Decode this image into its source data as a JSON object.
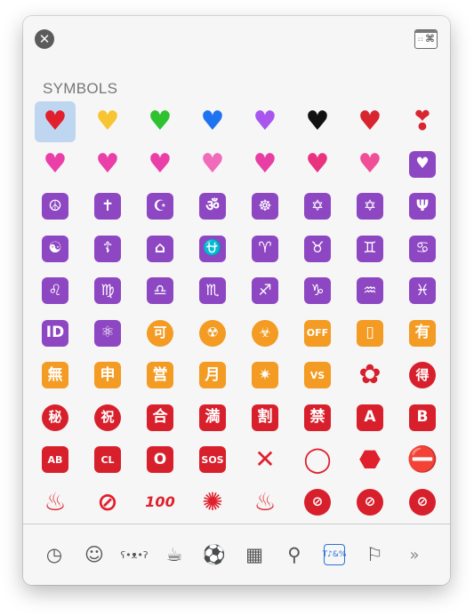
{
  "header": {
    "close_icon": "✕",
    "character_viewer_icon": "⌘",
    "character_viewer_dots": "::"
  },
  "section": {
    "title": "SYMBOLS"
  },
  "colors": {
    "purple": "#8e47c2",
    "orange": "#f39b22",
    "red": "#d8202c",
    "selection": "#bfd6f0",
    "active_category": "#2a72d9"
  },
  "rows": [
    [
      {
        "name": "red-heart-icon",
        "glyph": "♥",
        "style": "heart",
        "color": "#e0202c"
      },
      {
        "name": "yellow-heart-icon",
        "glyph": "♥",
        "style": "heart",
        "color": "#f7c531"
      },
      {
        "name": "green-heart-icon",
        "glyph": "♥",
        "style": "heart",
        "color": "#2ec130"
      },
      {
        "name": "blue-heart-icon",
        "glyph": "♥",
        "style": "heart",
        "color": "#1f73f0"
      },
      {
        "name": "purple-heart-icon",
        "glyph": "♥",
        "style": "heart",
        "color": "#a955f0"
      },
      {
        "name": "black-heart-icon",
        "glyph": "♥",
        "style": "heart",
        "color": "#111111"
      },
      {
        "name": "broken-heart-icon",
        "glyph": "♥",
        "style": "heart",
        "color": "#d9252f"
      },
      {
        "name": "heart-exclamation-icon",
        "glyph": "❣",
        "style": "heart",
        "color": "#d9252f"
      }
    ],
    [
      {
        "name": "two-hearts-icon",
        "glyph": "♥",
        "style": "heart",
        "color": "#ea3fa7"
      },
      {
        "name": "revolving-hearts-icon",
        "glyph": "♥",
        "style": "heart",
        "color": "#ea3fa7"
      },
      {
        "name": "beating-heart-icon",
        "glyph": "♥",
        "style": "heart",
        "color": "#ea3fa7"
      },
      {
        "name": "growing-heart-icon",
        "glyph": "♥",
        "style": "heart",
        "color": "#f06cbb"
      },
      {
        "name": "sparkling-heart-icon",
        "glyph": "♥",
        "style": "heart",
        "color": "#e83ea3"
      },
      {
        "name": "heart-with-arrow-icon",
        "glyph": "♥",
        "style": "heart",
        "color": "#e8337f"
      },
      {
        "name": "heart-with-ribbon-icon",
        "glyph": "♥",
        "style": "heart",
        "color": "#f04f98"
      },
      {
        "name": "heart-decoration-icon",
        "glyph": "♥",
        "style": "sq",
        "bg": "#8e47c2"
      }
    ],
    [
      {
        "name": "peace-symbol-icon",
        "glyph": "☮",
        "style": "sq",
        "bg": "#8e47c2"
      },
      {
        "name": "latin-cross-icon",
        "glyph": "✝",
        "style": "sq",
        "bg": "#8e47c2"
      },
      {
        "name": "star-and-crescent-icon",
        "glyph": "☪",
        "style": "sq",
        "bg": "#8e47c2"
      },
      {
        "name": "om-icon",
        "glyph": "ॐ",
        "style": "sq",
        "bg": "#8e47c2"
      },
      {
        "name": "wheel-of-dharma-icon",
        "glyph": "☸",
        "style": "sq",
        "bg": "#8e47c2"
      },
      {
        "name": "star-of-david-icon",
        "glyph": "✡",
        "style": "sq",
        "bg": "#8e47c2"
      },
      {
        "name": "dotted-six-pointed-star-icon",
        "glyph": "✡",
        "style": "sq",
        "bg": "#8e47c2"
      },
      {
        "name": "menorah-icon",
        "glyph": "Ψ",
        "style": "sq",
        "bg": "#8e47c2"
      }
    ],
    [
      {
        "name": "yin-yang-icon",
        "glyph": "☯",
        "style": "sq",
        "bg": "#8e47c2"
      },
      {
        "name": "orthodox-cross-icon",
        "glyph": "☦",
        "style": "sq",
        "bg": "#8e47c2"
      },
      {
        "name": "place-of-worship-icon",
        "glyph": "⌂",
        "style": "sq",
        "bg": "#8e47c2"
      },
      {
        "name": "ophiuchus-icon",
        "glyph": "⛎",
        "style": "sq",
        "bg": "#8e47c2"
      },
      {
        "name": "aries-icon",
        "glyph": "♈",
        "style": "sq",
        "bg": "#8e47c2"
      },
      {
        "name": "taurus-icon",
        "glyph": "♉",
        "style": "sq",
        "bg": "#8e47c2"
      },
      {
        "name": "gemini-icon",
        "glyph": "♊",
        "style": "sq",
        "bg": "#8e47c2"
      },
      {
        "name": "cancer-icon",
        "glyph": "♋",
        "style": "sq",
        "bg": "#8e47c2"
      }
    ],
    [
      {
        "name": "leo-icon",
        "glyph": "♌",
        "style": "sq",
        "bg": "#8e47c2"
      },
      {
        "name": "virgo-icon",
        "glyph": "♍",
        "style": "sq",
        "bg": "#8e47c2"
      },
      {
        "name": "libra-icon",
        "glyph": "♎",
        "style": "sq",
        "bg": "#8e47c2"
      },
      {
        "name": "scorpio-icon",
        "glyph": "♏",
        "style": "sq",
        "bg": "#8e47c2"
      },
      {
        "name": "sagittarius-icon",
        "glyph": "♐",
        "style": "sq",
        "bg": "#8e47c2"
      },
      {
        "name": "capricorn-icon",
        "glyph": "♑",
        "style": "sq",
        "bg": "#8e47c2"
      },
      {
        "name": "aquarius-icon",
        "glyph": "♒",
        "style": "sq",
        "bg": "#8e47c2"
      },
      {
        "name": "pisces-icon",
        "glyph": "♓",
        "style": "sq",
        "bg": "#8e47c2"
      }
    ],
    [
      {
        "name": "id-button-icon",
        "glyph": "ID",
        "style": "sq",
        "bg": "#8e47c2"
      },
      {
        "name": "atom-symbol-icon",
        "glyph": "⚛",
        "style": "sq",
        "bg": "#8e47c2"
      },
      {
        "name": "acceptable-button-icon",
        "glyph": "可",
        "style": "circ",
        "bg": "#f39b22"
      },
      {
        "name": "radioactive-icon",
        "glyph": "☢",
        "style": "circ",
        "bg": "#f39b22"
      },
      {
        "name": "biohazard-icon",
        "glyph": "☣",
        "style": "circ",
        "bg": "#f39b22"
      },
      {
        "name": "mobile-phone-off-icon",
        "glyph": "OFF",
        "style": "sq",
        "bg": "#f39b22",
        "small": true
      },
      {
        "name": "vibration-mode-icon",
        "glyph": "▯",
        "style": "sq",
        "bg": "#f39b22"
      },
      {
        "name": "not-free-of-charge-button-icon",
        "glyph": "有",
        "style": "sq",
        "bg": "#f39b22"
      }
    ],
    [
      {
        "name": "free-of-charge-button-icon",
        "glyph": "無",
        "style": "sq",
        "bg": "#f39b22"
      },
      {
        "name": "application-button-icon",
        "glyph": "申",
        "style": "sq",
        "bg": "#f39b22"
      },
      {
        "name": "open-for-business-button-icon",
        "glyph": "営",
        "style": "sq",
        "bg": "#f39b22"
      },
      {
        "name": "monthly-amount-button-icon",
        "glyph": "月",
        "style": "sq",
        "bg": "#f39b22"
      },
      {
        "name": "eight-pointed-star-icon",
        "glyph": "✷",
        "style": "sq",
        "bg": "#f39b22"
      },
      {
        "name": "vs-button-icon",
        "glyph": "VS",
        "style": "sq",
        "bg": "#f39b22",
        "small": true
      },
      {
        "name": "white-flower-icon",
        "glyph": "✿",
        "style": "heart",
        "color": "#d8202c"
      },
      {
        "name": "bargain-button-icon",
        "glyph": "得",
        "style": "circ",
        "bg": "#d8202c"
      }
    ],
    [
      {
        "name": "secret-button-icon",
        "glyph": "秘",
        "style": "circ",
        "bg": "#d8202c"
      },
      {
        "name": "congratulations-button-icon",
        "glyph": "祝",
        "style": "circ",
        "bg": "#d8202c"
      },
      {
        "name": "passing-grade-button-icon",
        "glyph": "合",
        "style": "sq",
        "bg": "#d8202c"
      },
      {
        "name": "no-vacancy-button-icon",
        "glyph": "満",
        "style": "sq",
        "bg": "#d8202c"
      },
      {
        "name": "discount-button-icon",
        "glyph": "割",
        "style": "sq",
        "bg": "#d8202c"
      },
      {
        "name": "prohibited-button-icon",
        "glyph": "禁",
        "style": "sq",
        "bg": "#d8202c"
      },
      {
        "name": "a-button-icon",
        "glyph": "A",
        "style": "sq",
        "bg": "#d8202c"
      },
      {
        "name": "b-button-icon",
        "glyph": "B",
        "style": "sq",
        "bg": "#d8202c"
      }
    ],
    [
      {
        "name": "ab-button-icon",
        "glyph": "AB",
        "style": "sq",
        "bg": "#d8202c",
        "small": true
      },
      {
        "name": "cl-button-icon",
        "glyph": "CL",
        "style": "sq",
        "bg": "#d8202c",
        "small": true
      },
      {
        "name": "o-button-icon",
        "glyph": "O",
        "style": "sq",
        "bg": "#d8202c"
      },
      {
        "name": "sos-button-icon",
        "glyph": "SOS",
        "style": "sq",
        "bg": "#d8202c",
        "small": true
      },
      {
        "name": "cross-mark-icon",
        "glyph": "✕",
        "style": "plain",
        "color": "#e0202c"
      },
      {
        "name": "hollow-red-circle-icon",
        "glyph": "◯",
        "style": "plain",
        "color": "#e0202c"
      },
      {
        "name": "stop-sign-icon",
        "glyph": "⬣",
        "style": "plain",
        "color": "#e0202c"
      },
      {
        "name": "no-entry-icon",
        "glyph": "⛔",
        "style": "plain",
        "color": "#e0202c"
      }
    ],
    [
      {
        "name": "name-badge-icon",
        "glyph": "♨",
        "style": "plain",
        "color": "#e0202c"
      },
      {
        "name": "prohibited-icon",
        "glyph": "⊘",
        "style": "plain",
        "color": "#e0202c"
      },
      {
        "name": "hundred-points-icon",
        "glyph": "100",
        "style": "plain",
        "color": "#e0202c",
        "small": true
      },
      {
        "name": "anger-symbol-icon",
        "glyph": "✺",
        "style": "plain",
        "color": "#e0202c"
      },
      {
        "name": "hot-springs-icon",
        "glyph": "♨",
        "style": "plain",
        "color": "#e0202c"
      },
      {
        "name": "no-pedestrians-icon",
        "glyph": "⊘",
        "style": "circ",
        "bg": "#d8202c"
      },
      {
        "name": "no-littering-icon",
        "glyph": "⊘",
        "style": "circ",
        "bg": "#d8202c"
      },
      {
        "name": "no-bicycles-icon",
        "glyph": "⊘",
        "style": "circ",
        "bg": "#d8202c"
      }
    ],
    [
      {
        "name": "non-potable-water-icon",
        "glyph": "⊘",
        "style": "circ",
        "bg": "#d8202c"
      },
      {
        "name": "no-one-under-eighteen-icon",
        "glyph": "⊘",
        "style": "circ",
        "bg": "#d8202c"
      },
      {
        "name": "no-mobile-phones-icon",
        "glyph": "⊘",
        "style": "circ",
        "bg": "#d8202c"
      },
      {
        "name": "no-smoking-icon",
        "glyph": "⊘",
        "style": "circ",
        "bg": "#d8202c"
      },
      {
        "name": "exclamation-mark-icon",
        "glyph": "!",
        "style": "plain",
        "color": "#e0202c"
      },
      {
        "name": "white-exclamation-mark-icon",
        "glyph": "!",
        "style": "plain",
        "color": "#d9d9d9"
      },
      {
        "name": "question-mark-icon",
        "glyph": "?",
        "style": "plain",
        "color": "#e0202c"
      },
      {
        "name": "white-question-mark-icon",
        "glyph": "?",
        "style": "plain",
        "color": "#d9d9d9"
      }
    ]
  ],
  "categories": [
    {
      "name": "recently-used-icon",
      "glyph": "◷"
    },
    {
      "name": "smileys-people-icon",
      "glyph": "☺"
    },
    {
      "name": "animals-nature-icon",
      "glyph": "ʕ•ᴥ•ʔ",
      "small": true
    },
    {
      "name": "food-drink-icon",
      "glyph": "☕"
    },
    {
      "name": "activity-icon",
      "glyph": "⚽"
    },
    {
      "name": "travel-places-icon",
      "glyph": "▦"
    },
    {
      "name": "objects-icon",
      "glyph": "⚲"
    },
    {
      "name": "symbols-icon",
      "glyph": "T♪&%",
      "active": true
    },
    {
      "name": "flags-icon",
      "glyph": "⚐"
    },
    {
      "name": "more-icon",
      "glyph": "»"
    }
  ]
}
